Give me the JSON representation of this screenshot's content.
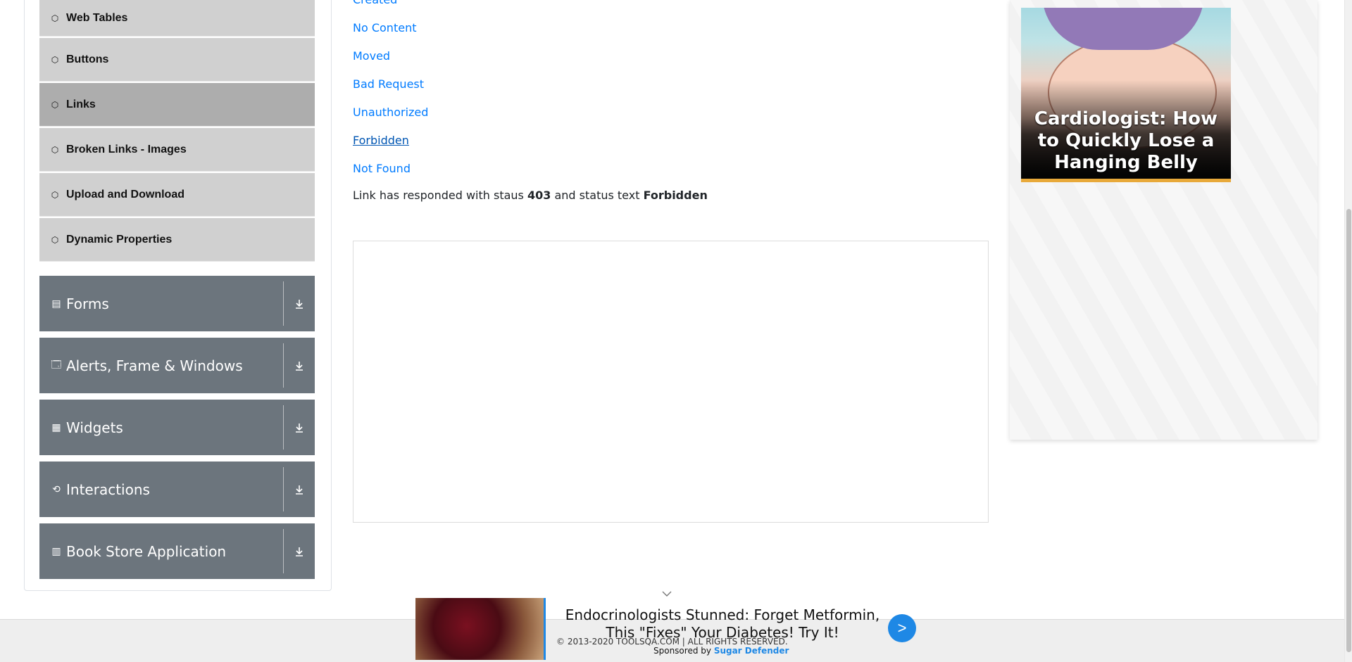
{
  "sidebar": {
    "sub_items": [
      {
        "label": "Web Tables",
        "icon": "hex-icon"
      },
      {
        "label": "Buttons",
        "icon": "hex-icon"
      },
      {
        "label": "Links",
        "icon": "hex-icon",
        "active": true
      },
      {
        "label": "Broken Links - Images",
        "icon": "hex-icon"
      },
      {
        "label": "Upload and Download",
        "icon": "hex-icon"
      },
      {
        "label": "Dynamic Properties",
        "icon": "hex-icon"
      }
    ],
    "groups": [
      {
        "label": "Forms",
        "icon": "form-icon"
      },
      {
        "label": "Alerts, Frame & Windows",
        "icon": "window-icon"
      },
      {
        "label": "Widgets",
        "icon": "widgets-icon"
      },
      {
        "label": "Interactions",
        "icon": "interactions-icon"
      },
      {
        "label": "Book Store Application",
        "icon": "books-icon"
      }
    ]
  },
  "main": {
    "links": [
      "Created",
      "No Content",
      "Moved",
      "Bad Request",
      "Unauthorized",
      "Forbidden",
      "Not Found"
    ],
    "response": {
      "prefix": "Link has responded with staus",
      "status_code": "403",
      "middle": "and status text",
      "status_text": "Forbidden"
    }
  },
  "right_ad": {
    "headline": "Cardiologist: How to Quickly Lose a Hanging Belly"
  },
  "footer": {
    "copyright": "© 2013-2020 TOOLSQA.COM | ALL RIGHTS RESERVED."
  },
  "sticky_ad": {
    "title": "Endocrinologists Stunned: Forget Metformin, This \"Fixes\" Your Diabetes! Try It!",
    "sponsored_prefix": "Sponsored by",
    "sponsor": "Sugar Defender",
    "next_label": ">"
  },
  "colors": {
    "link": "#007bff",
    "group_bg": "#6c757d",
    "sub_item_bg": "#d0d0d0",
    "active_bg": "#adadad",
    "accent": "#1e88e5"
  }
}
